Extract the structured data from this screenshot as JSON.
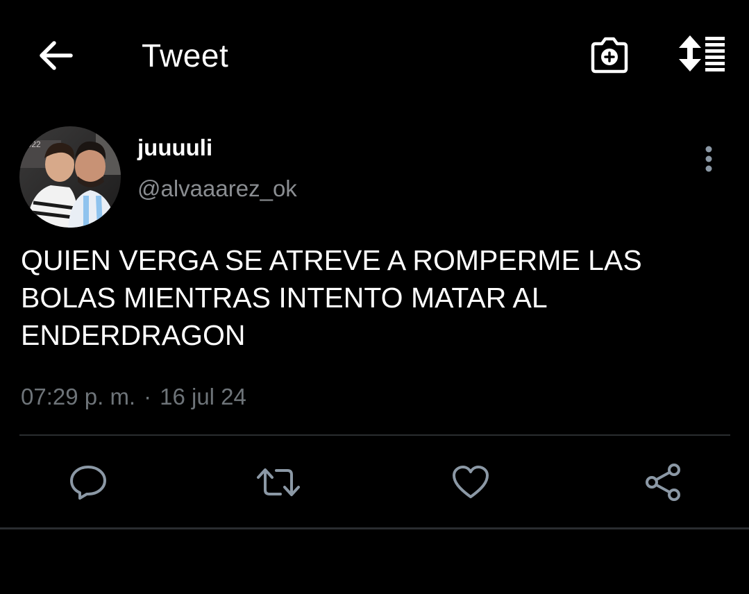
{
  "header": {
    "title": "Tweet",
    "back_icon": "arrow-left-icon",
    "camera_icon": "camera-plus-icon",
    "sort_icon": "sort-list-icon"
  },
  "tweet": {
    "author": {
      "display_name": "juuuuli",
      "handle": "@alvaaarez_ok"
    },
    "text": "QUIEN VERGA SE ATREVE A ROMPERME LAS\nBOLAS MIENTRAS INTENTO MATAR AL\nENDERDRAGON",
    "time": "07:29 p. m.",
    "separator": "·",
    "date": "16 jul 24"
  },
  "actions": [
    "reply-icon",
    "retweet-icon",
    "like-icon",
    "share-icon"
  ],
  "colors": {
    "background": "#000000",
    "text": "#ffffff",
    "secondary_text": "#8a8d91",
    "meta_text": "#6e7479",
    "icon": "#8b98a5",
    "divider": "#2a2d30"
  }
}
